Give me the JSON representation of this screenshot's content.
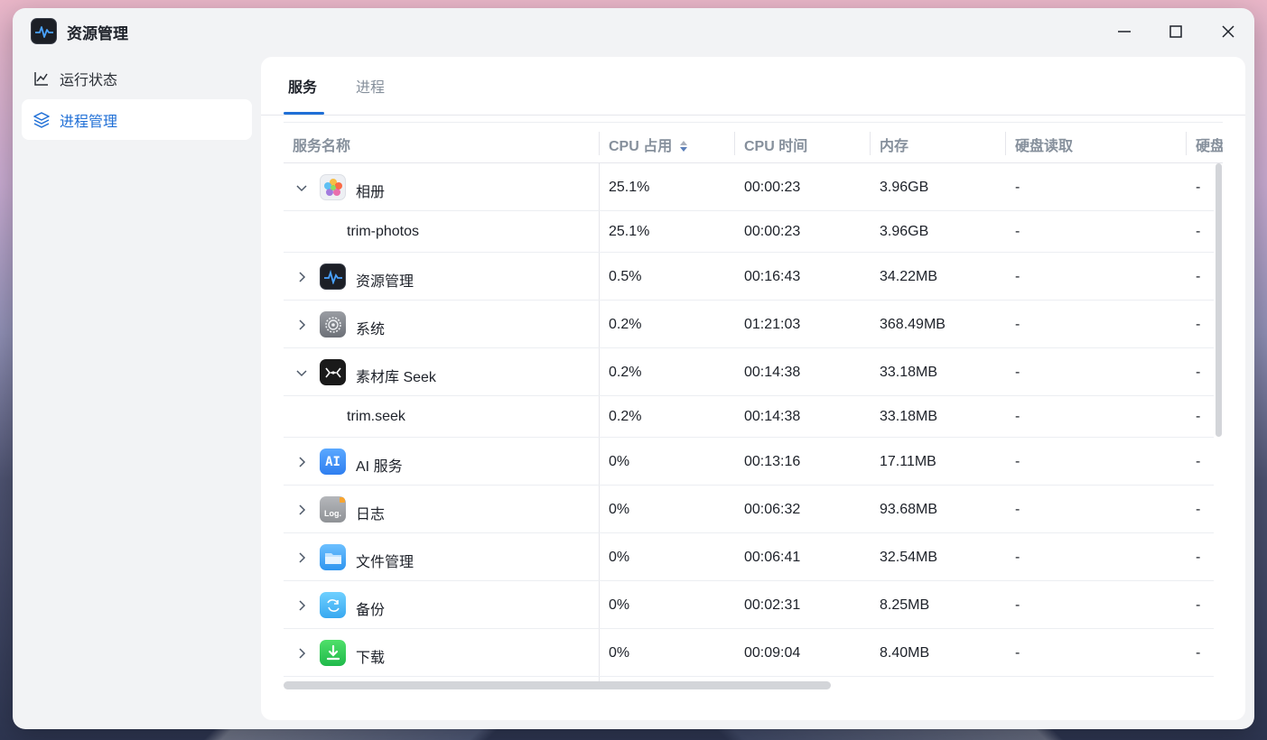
{
  "window": {
    "title": "资源管理"
  },
  "sidebar": {
    "items": [
      {
        "label": "运行状态",
        "icon": "chart-line-icon",
        "active": false
      },
      {
        "label": "进程管理",
        "icon": "layers-icon",
        "active": true
      }
    ]
  },
  "tabs": [
    {
      "label": "服务",
      "active": true
    },
    {
      "label": "进程",
      "active": false
    }
  ],
  "table": {
    "headers": {
      "name": "服务名称",
      "cpu": "CPU 占用",
      "cpu_time": "CPU 时间",
      "memory": "内存",
      "disk_read": "硬盘读取",
      "disk_write": "硬盘"
    },
    "rows": [
      {
        "name": "相册",
        "cpu": "25.1%",
        "time": "00:00:23",
        "mem": "3.96GB",
        "read": "-",
        "write": "-",
        "icon": "photos-icon",
        "expanded": true,
        "child": false
      },
      {
        "name": "trim-photos",
        "cpu": "25.1%",
        "time": "00:00:23",
        "mem": "3.96GB",
        "read": "-",
        "write": "-",
        "child": true
      },
      {
        "name": "资源管理",
        "cpu": "0.5%",
        "time": "00:16:43",
        "mem": "34.22MB",
        "read": "-",
        "write": "-",
        "icon": "resource-monitor-icon",
        "expanded": false,
        "child": false
      },
      {
        "name": "系统",
        "cpu": "0.2%",
        "time": "01:21:03",
        "mem": "368.49MB",
        "read": "-",
        "write": "-",
        "icon": "system-gear-icon",
        "expanded": false,
        "child": false
      },
      {
        "name": "素材库 Seek",
        "cpu": "0.2%",
        "time": "00:14:38",
        "mem": "33.18MB",
        "read": "-",
        "write": "-",
        "icon": "seek-icon",
        "expanded": true,
        "child": false
      },
      {
        "name": "trim.seek",
        "cpu": "0.2%",
        "time": "00:14:38",
        "mem": "33.18MB",
        "read": "-",
        "write": "-",
        "child": true
      },
      {
        "name": "AI 服务",
        "cpu": "0%",
        "time": "00:13:16",
        "mem": "17.11MB",
        "read": "-",
        "write": "-",
        "icon": "ai-icon",
        "expanded": false,
        "child": false
      },
      {
        "name": "日志",
        "cpu": "0%",
        "time": "00:06:32",
        "mem": "93.68MB",
        "read": "-",
        "write": "-",
        "icon": "log-icon",
        "expanded": false,
        "child": false
      },
      {
        "name": "文件管理",
        "cpu": "0%",
        "time": "00:06:41",
        "mem": "32.54MB",
        "read": "-",
        "write": "-",
        "icon": "folder-icon",
        "expanded": false,
        "child": false
      },
      {
        "name": "备份",
        "cpu": "0%",
        "time": "00:02:31",
        "mem": "8.25MB",
        "read": "-",
        "write": "-",
        "icon": "backup-icon",
        "expanded": false,
        "child": false
      },
      {
        "name": "下载",
        "cpu": "0%",
        "time": "00:09:04",
        "mem": "8.40MB",
        "read": "-",
        "write": "-",
        "icon": "download-icon",
        "expanded": false,
        "child": false
      }
    ]
  },
  "colors": {
    "accent": "#1f6fd6",
    "text": "#1d2129",
    "muted": "#86909c"
  },
  "icon_texts": {
    "ai": "AI",
    "log": "Log."
  }
}
